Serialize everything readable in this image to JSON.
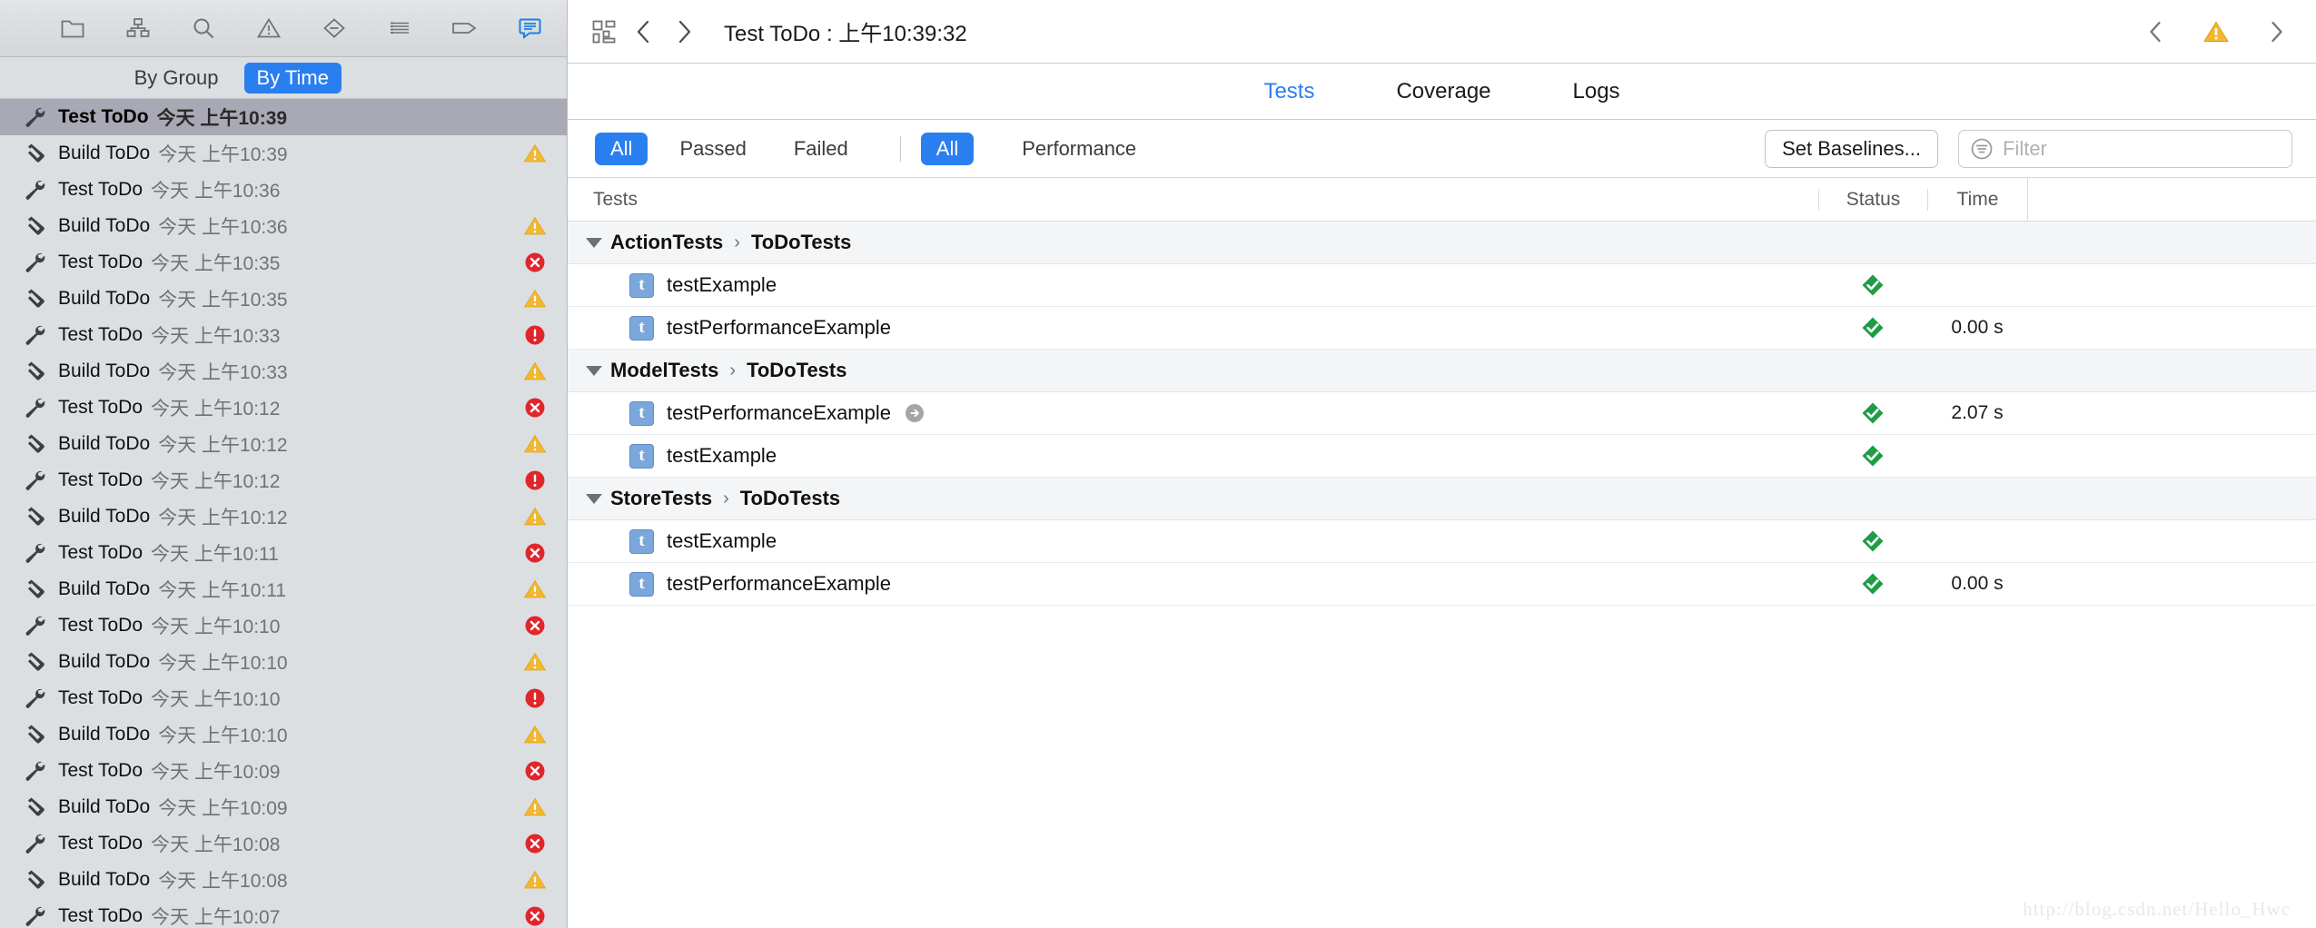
{
  "navigator": {
    "toolbar_icons": [
      {
        "name": "folder-icon"
      },
      {
        "name": "source-control-icon"
      },
      {
        "name": "search-icon"
      },
      {
        "name": "issue-warning-icon"
      },
      {
        "name": "test-diamond-icon"
      },
      {
        "name": "debug-list-icon"
      },
      {
        "name": "breakpoint-tag-icon"
      },
      {
        "name": "report-message-icon"
      }
    ],
    "grouping": {
      "by_group_label": "By Group",
      "by_time_label": "By Time",
      "selected": "By Time"
    },
    "rows": [
      {
        "kind": "test",
        "label": "Test ToDo",
        "time": "今天 上午10:39",
        "badge": "none",
        "selected": true
      },
      {
        "kind": "build",
        "label": "Build ToDo",
        "time": "今天 上午10:39",
        "badge": "warning",
        "selected": false
      },
      {
        "kind": "test",
        "label": "Test ToDo",
        "time": "今天 上午10:36",
        "badge": "none",
        "selected": false
      },
      {
        "kind": "build",
        "label": "Build ToDo",
        "time": "今天 上午10:36",
        "badge": "warning",
        "selected": false
      },
      {
        "kind": "test",
        "label": "Test ToDo",
        "time": "今天 上午10:35",
        "badge": "error-x",
        "selected": false
      },
      {
        "kind": "build",
        "label": "Build ToDo",
        "time": "今天 上午10:35",
        "badge": "warning",
        "selected": false
      },
      {
        "kind": "test",
        "label": "Test ToDo",
        "time": "今天 上午10:33",
        "badge": "error-!",
        "selected": false
      },
      {
        "kind": "build",
        "label": "Build ToDo",
        "time": "今天 上午10:33",
        "badge": "warning",
        "selected": false
      },
      {
        "kind": "test",
        "label": "Test ToDo",
        "time": "今天 上午10:12",
        "badge": "error-x",
        "selected": false
      },
      {
        "kind": "build",
        "label": "Build ToDo",
        "time": "今天 上午10:12",
        "badge": "warning",
        "selected": false
      },
      {
        "kind": "test",
        "label": "Test ToDo",
        "time": "今天 上午10:12",
        "badge": "error-!",
        "selected": false
      },
      {
        "kind": "build",
        "label": "Build ToDo",
        "time": "今天 上午10:12",
        "badge": "warning",
        "selected": false
      },
      {
        "kind": "test",
        "label": "Test ToDo",
        "time": "今天 上午10:11",
        "badge": "error-x",
        "selected": false
      },
      {
        "kind": "build",
        "label": "Build ToDo",
        "time": "今天 上午10:11",
        "badge": "warning",
        "selected": false
      },
      {
        "kind": "test",
        "label": "Test ToDo",
        "time": "今天 上午10:10",
        "badge": "error-x",
        "selected": false
      },
      {
        "kind": "build",
        "label": "Build ToDo",
        "time": "今天 上午10:10",
        "badge": "warning",
        "selected": false
      },
      {
        "kind": "test",
        "label": "Test ToDo",
        "time": "今天 上午10:10",
        "badge": "error-!",
        "selected": false
      },
      {
        "kind": "build",
        "label": "Build ToDo",
        "time": "今天 上午10:10",
        "badge": "warning",
        "selected": false
      },
      {
        "kind": "test",
        "label": "Test ToDo",
        "time": "今天 上午10:09",
        "badge": "error-x",
        "selected": false
      },
      {
        "kind": "build",
        "label": "Build ToDo",
        "time": "今天 上午10:09",
        "badge": "warning",
        "selected": false
      },
      {
        "kind": "test",
        "label": "Test ToDo",
        "time": "今天 上午10:08",
        "badge": "error-x",
        "selected": false
      },
      {
        "kind": "build",
        "label": "Build ToDo",
        "time": "今天 上午10:08",
        "badge": "warning",
        "selected": false
      },
      {
        "kind": "test",
        "label": "Test ToDo",
        "time": "今天 上午10:07",
        "badge": "error-x",
        "selected": false
      }
    ]
  },
  "jumpbar": {
    "title": "Test ToDo : 上午10:39:32",
    "grid_icon": "assistant-grid-icon",
    "back_icon": "chevron-left-icon",
    "forward_icon": "chevron-right-icon",
    "right_back_icon": "chevron-left-icon",
    "right_warning_icon": "warning-triangle-icon",
    "right_forward_icon": "chevron-right-icon"
  },
  "tabs": [
    {
      "label": "Tests",
      "active": true
    },
    {
      "label": "Coverage",
      "active": false
    },
    {
      "label": "Logs",
      "active": false
    }
  ],
  "filterbar": {
    "result_segments": [
      {
        "label": "All",
        "active": true
      },
      {
        "label": "Passed",
        "active": false
      },
      {
        "label": "Failed",
        "active": false
      }
    ],
    "perf_segments": [
      {
        "label": "All",
        "active": true
      },
      {
        "label": "Performance",
        "active": false
      }
    ],
    "set_baselines_label": "Set Baselines...",
    "filter_placeholder": "Filter",
    "filter_value": ""
  },
  "results": {
    "columns": {
      "tests": "Tests",
      "status": "Status",
      "time": "Time"
    },
    "groups": [
      {
        "suite": "ActionTests",
        "target": "ToDoTests",
        "expanded": true,
        "tests": [
          {
            "name": "testExample",
            "status": "passed",
            "time": "",
            "disclosure": false
          },
          {
            "name": "testPerformanceExample",
            "status": "passed",
            "time": "0.00 s",
            "disclosure": false
          }
        ]
      },
      {
        "suite": "ModelTests",
        "target": "ToDoTests",
        "expanded": true,
        "tests": [
          {
            "name": "testPerformanceExample",
            "status": "passed",
            "time": "2.07 s",
            "disclosure": true
          },
          {
            "name": "testExample",
            "status": "passed",
            "time": "",
            "disclosure": false
          }
        ]
      },
      {
        "suite": "StoreTests",
        "target": "ToDoTests",
        "expanded": true,
        "tests": [
          {
            "name": "testExample",
            "status": "passed",
            "time": "",
            "disclosure": false
          },
          {
            "name": "testPerformanceExample",
            "status": "passed",
            "time": "0.00 s",
            "disclosure": false
          }
        ]
      }
    ]
  },
  "watermark": "http://blog.csdn.net/Hello_Hwc",
  "colors": {
    "accent_blue": "#2a7ff0",
    "pass_green": "#1f9d45",
    "warning_yellow": "#f5b731",
    "error_red": "#e0262b",
    "selection_gray": "#a8a9b4"
  }
}
